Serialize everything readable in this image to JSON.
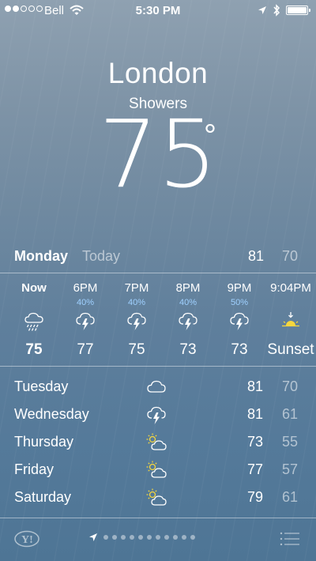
{
  "status_bar": {
    "carrier": "Bell",
    "time": "5:30 PM",
    "signal_dots_filled": 2,
    "signal_dots_total": 5
  },
  "current": {
    "city": "London",
    "condition": "Showers",
    "temperature": "75",
    "degree_symbol": "°"
  },
  "today": {
    "day": "Monday",
    "label": "Today",
    "high": "81",
    "low": "70"
  },
  "hourly": [
    {
      "time": "Now",
      "pop": "",
      "icon": "rain-icon",
      "temp": "75"
    },
    {
      "time": "6PM",
      "pop": "40%",
      "icon": "thunderstorm-icon",
      "temp": "77"
    },
    {
      "time": "7PM",
      "pop": "40%",
      "icon": "thunderstorm-icon",
      "temp": "75"
    },
    {
      "time": "8PM",
      "pop": "40%",
      "icon": "thunderstorm-icon",
      "temp": "73"
    },
    {
      "time": "9PM",
      "pop": "50%",
      "icon": "thunderstorm-icon",
      "temp": "73"
    },
    {
      "time": "9:04PM",
      "pop": "",
      "icon": "sunset-icon",
      "temp": "Sunset"
    }
  ],
  "daily": [
    {
      "day": "Tuesday",
      "icon": "cloud-icon",
      "high": "81",
      "low": "70"
    },
    {
      "day": "Wednesday",
      "icon": "thunderstorm-icon",
      "high": "81",
      "low": "61"
    },
    {
      "day": "Thursday",
      "icon": "partly-cloudy-icon",
      "high": "73",
      "low": "55"
    },
    {
      "day": "Friday",
      "icon": "partly-cloudy-icon",
      "high": "77",
      "low": "57"
    },
    {
      "day": "Saturday",
      "icon": "partly-cloudy-icon",
      "high": "79",
      "low": "61"
    }
  ],
  "footer": {
    "logo": "Y!",
    "page_count": 11
  },
  "colors": {
    "pop_blue": "#9fd0ff",
    "sun_yellow": "#f5d63d",
    "muted_text": "rgba(255,255,255,0.55)"
  }
}
